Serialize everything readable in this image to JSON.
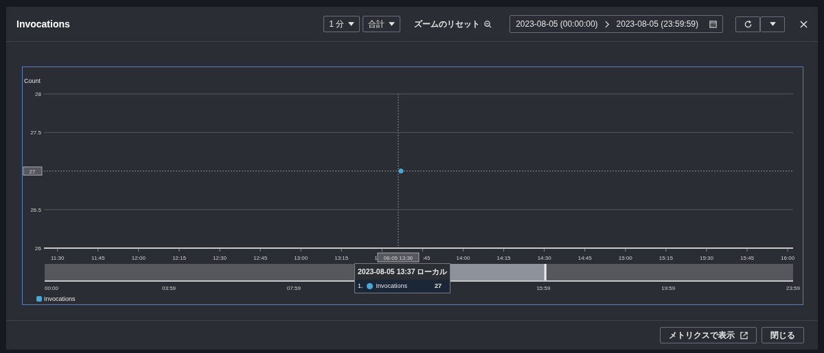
{
  "window": {
    "title": "Invocations"
  },
  "toolbar": {
    "period": "1 分",
    "statistic": "合計",
    "reset_zoom": "ズームのリセット",
    "date_start": "2023-08-05 (00:00:00)",
    "date_end": "2023-08-05 (23:59:59)"
  },
  "chart": {
    "chart_data": {
      "type": "scatter",
      "ylabel": "Count",
      "xlim": [
        685,
        962
      ],
      "ylim": [
        26,
        28
      ],
      "yticks": [
        26,
        26.5,
        27.5,
        28
      ],
      "xticks": [
        {
          "value": 690,
          "label": "11:30"
        },
        {
          "value": 705,
          "label": "11:45"
        },
        {
          "value": 720,
          "label": "12:00"
        },
        {
          "value": 735,
          "label": "12:15"
        },
        {
          "value": 750,
          "label": "12:30"
        },
        {
          "value": 765,
          "label": "12:45"
        },
        {
          "value": 780,
          "label": "13:00"
        },
        {
          "value": 795,
          "label": "13:15"
        },
        {
          "value": 840,
          "label": "14:00"
        },
        {
          "value": 855,
          "label": "14:15"
        },
        {
          "value": 870,
          "label": "14:30"
        },
        {
          "value": 885,
          "label": "14:45"
        },
        {
          "value": 900,
          "label": "15:00"
        },
        {
          "value": 915,
          "label": "15:15"
        },
        {
          "value": 930,
          "label": "15:30"
        },
        {
          "value": 945,
          "label": "15:45"
        },
        {
          "value": 960,
          "label": "16:00"
        }
      ],
      "x": [
        817
      ],
      "series": [
        {
          "name": "Invocations",
          "color": "#4aa8d8",
          "values": [
            27
          ]
        }
      ]
    },
    "crosshair": {
      "x_label": "08-05 13:36",
      "y_label": "27",
      "covered_tick_fragments": [
        "1",
        ":45"
      ]
    },
    "navigator": {
      "ticks": [
        "00:00",
        "03:59",
        "07:59",
        "15:59",
        "19:59",
        "23:59"
      ]
    },
    "tooltip": {
      "title": "2023-08-05 13:37 ローカル",
      "rows": [
        {
          "index": "1.",
          "name": "Invocations",
          "value": "27",
          "color": "#4aa8d8"
        }
      ]
    },
    "tooltip_visible": true
  },
  "footer": {
    "buttons": [
      "メトリクスで表示",
      "閉じる"
    ]
  }
}
